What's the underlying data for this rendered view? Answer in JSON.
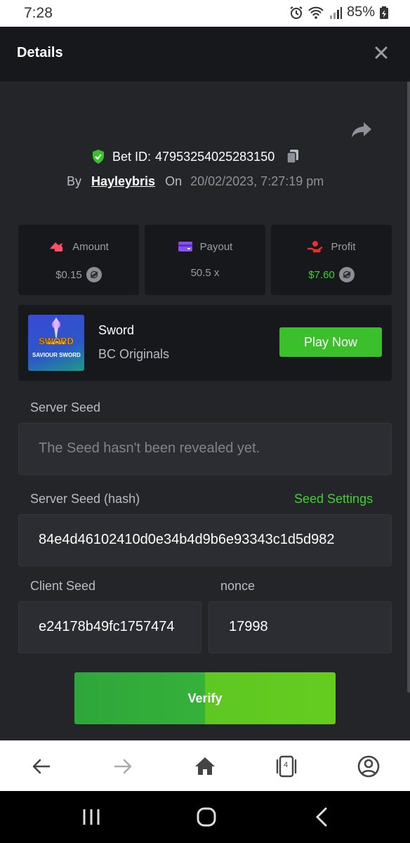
{
  "status_bar": {
    "time": "7:28",
    "battery": "85%"
  },
  "header": {
    "title": "Details"
  },
  "bet": {
    "id_prefix": "Bet ID:",
    "id": "47953254025283150",
    "by_label": "By",
    "user": "Hayleybris",
    "on_label": "On",
    "date": "20/02/2023, 7:27:19 pm"
  },
  "stats": [
    {
      "label": "Amount",
      "value": "$0.15",
      "icon": "money-wings-icon",
      "color": "#ff4d6a"
    },
    {
      "label": "Payout",
      "value": "50.5 x",
      "icon": "card-icon",
      "color": "#8a4ef2"
    },
    {
      "label": "Profit",
      "value": "$7.60",
      "icon": "profit-hand-icon",
      "color": "#e8302f"
    }
  ],
  "game": {
    "name": "Sword",
    "provider": "BC Originals",
    "play_label": "Play Now",
    "thumb_text_top": "SWORD",
    "thumb_text_bottom": "SAVIOUR SWORD"
  },
  "seeds": {
    "server_seed_label": "Server Seed",
    "server_seed_placeholder": "The Seed hasn't been revealed yet.",
    "server_hash_label": "Server Seed (hash)",
    "seed_settings_label": "Seed Settings",
    "server_hash": "84e4d46102410d0e34b4d9b6e93343c1d5d982",
    "client_seed_label": "Client Seed",
    "client_seed": "e24178b49fc1757474",
    "nonce_label": "nonce",
    "nonce": "17998"
  },
  "verify_label": "Verify",
  "browser": {
    "tab_count": "4"
  },
  "colors": {
    "accent_green": "#3bc02b",
    "bg": "#232529",
    "panel": "#17181b"
  }
}
